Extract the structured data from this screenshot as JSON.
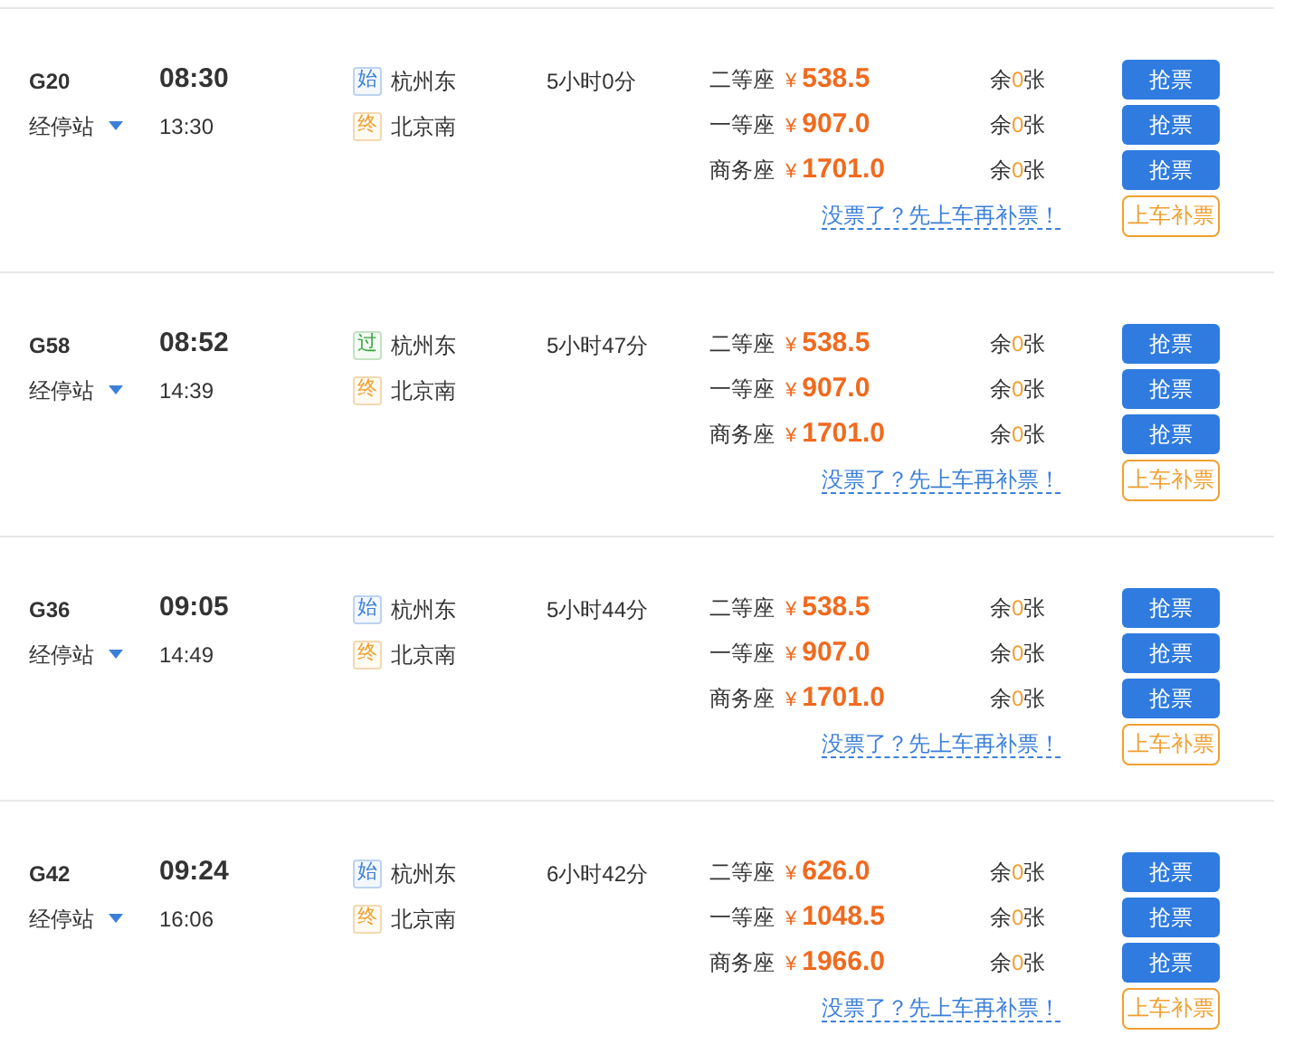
{
  "trains": [
    {
      "number": "G20",
      "stops_label": "经停站",
      "depart": "08:30",
      "arrive": "13:30",
      "stations": [
        {
          "kind": "start",
          "badge": "始",
          "name": "杭州东"
        },
        {
          "kind": "end",
          "badge": "终",
          "name": "北京南"
        }
      ],
      "duration": "5小时0分",
      "seats": [
        {
          "name": "二等座",
          "currency": "¥",
          "price": "538.5",
          "remain_prefix": "余",
          "remain": "0",
          "remain_suffix": "张",
          "button": "抢票"
        },
        {
          "name": "一等座",
          "currency": "¥",
          "price": "907.0",
          "remain_prefix": "余",
          "remain": "0",
          "remain_suffix": "张",
          "button": "抢票"
        },
        {
          "name": "商务座",
          "currency": "¥",
          "price": "1701.0",
          "remain_prefix": "余",
          "remain": "0",
          "remain_suffix": "张",
          "button": "抢票"
        }
      ],
      "hint": "没票了？先上车再补票！",
      "board_button": "上车补票"
    },
    {
      "number": "G58",
      "stops_label": "经停站",
      "depart": "08:52",
      "arrive": "14:39",
      "stations": [
        {
          "kind": "pass",
          "badge": "过",
          "name": "杭州东"
        },
        {
          "kind": "end",
          "badge": "终",
          "name": "北京南"
        }
      ],
      "duration": "5小时47分",
      "seats": [
        {
          "name": "二等座",
          "currency": "¥",
          "price": "538.5",
          "remain_prefix": "余",
          "remain": "0",
          "remain_suffix": "张",
          "button": "抢票"
        },
        {
          "name": "一等座",
          "currency": "¥",
          "price": "907.0",
          "remain_prefix": "余",
          "remain": "0",
          "remain_suffix": "张",
          "button": "抢票"
        },
        {
          "name": "商务座",
          "currency": "¥",
          "price": "1701.0",
          "remain_prefix": "余",
          "remain": "0",
          "remain_suffix": "张",
          "button": "抢票"
        }
      ],
      "hint": "没票了？先上车再补票！",
      "board_button": "上车补票"
    },
    {
      "number": "G36",
      "stops_label": "经停站",
      "depart": "09:05",
      "arrive": "14:49",
      "stations": [
        {
          "kind": "start",
          "badge": "始",
          "name": "杭州东"
        },
        {
          "kind": "end",
          "badge": "终",
          "name": "北京南"
        }
      ],
      "duration": "5小时44分",
      "seats": [
        {
          "name": "二等座",
          "currency": "¥",
          "price": "538.5",
          "remain_prefix": "余",
          "remain": "0",
          "remain_suffix": "张",
          "button": "抢票"
        },
        {
          "name": "一等座",
          "currency": "¥",
          "price": "907.0",
          "remain_prefix": "余",
          "remain": "0",
          "remain_suffix": "张",
          "button": "抢票"
        },
        {
          "name": "商务座",
          "currency": "¥",
          "price": "1701.0",
          "remain_prefix": "余",
          "remain": "0",
          "remain_suffix": "张",
          "button": "抢票"
        }
      ],
      "hint": "没票了？先上车再补票！",
      "board_button": "上车补票"
    },
    {
      "number": "G42",
      "stops_label": "经停站",
      "depart": "09:24",
      "arrive": "16:06",
      "stations": [
        {
          "kind": "start",
          "badge": "始",
          "name": "杭州东"
        },
        {
          "kind": "end",
          "badge": "终",
          "name": "北京南"
        }
      ],
      "duration": "6小时42分",
      "seats": [
        {
          "name": "二等座",
          "currency": "¥",
          "price": "626.0",
          "remain_prefix": "余",
          "remain": "0",
          "remain_suffix": "张",
          "button": "抢票"
        },
        {
          "name": "一等座",
          "currency": "¥",
          "price": "1048.5",
          "remain_prefix": "余",
          "remain": "0",
          "remain_suffix": "张",
          "button": "抢票"
        },
        {
          "name": "商务座",
          "currency": "¥",
          "price": "1966.0",
          "remain_prefix": "余",
          "remain": "0",
          "remain_suffix": "张",
          "button": "抢票"
        }
      ],
      "hint": "没票了？先上车再补票！",
      "board_button": "上车补票"
    }
  ]
}
